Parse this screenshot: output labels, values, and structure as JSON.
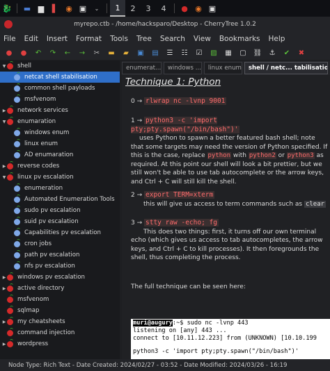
{
  "topbar": {
    "workspaces": [
      "1",
      "2",
      "3",
      "4"
    ],
    "active_workspace": "1"
  },
  "window": {
    "title": "myrepo.ctb - /home/hacksparo/Desktop - CherryTree 1.0.2"
  },
  "menu": [
    "File",
    "Edit",
    "Insert",
    "Format",
    "Tools",
    "Tree",
    "Search",
    "View",
    "Bookmarks",
    "Help"
  ],
  "tree": [
    {
      "label": "shell",
      "level": 0,
      "expanded": true
    },
    {
      "label": "netcat shell stabilisation",
      "level": 1,
      "selected": true
    },
    {
      "label": "common shell payloads",
      "level": 1
    },
    {
      "label": "msfvenom",
      "level": 1
    },
    {
      "label": "network services",
      "level": 0,
      "collapsed": true
    },
    {
      "label": "enumaration",
      "level": 0,
      "expanded": true
    },
    {
      "label": "windows enum",
      "level": 1
    },
    {
      "label": "linux enum",
      "level": 1
    },
    {
      "label": "AD enumaration",
      "level": 1
    },
    {
      "label": "reverse codes",
      "level": 0,
      "collapsed": true
    },
    {
      "label": "linux pv escalation",
      "level": 0,
      "expanded": true
    },
    {
      "label": "enumeration",
      "level": 1
    },
    {
      "label": "Automated Enumeration Tools",
      "level": 1
    },
    {
      "label": "sudo pv escalation",
      "level": 1
    },
    {
      "label": "suid pv escalation",
      "level": 1
    },
    {
      "label": "Capabilities pv escalation",
      "level": 1
    },
    {
      "label": "cron jobs",
      "level": 1
    },
    {
      "label": "path pv escalation",
      "level": 1
    },
    {
      "label": "nfs pv escalation",
      "level": 1
    },
    {
      "label": "windows pv escalation",
      "level": 0,
      "collapsed": true
    },
    {
      "label": "active directory",
      "level": 0,
      "collapsed": true
    },
    {
      "label": "msfvenom",
      "level": 0
    },
    {
      "label": "sqlmap",
      "level": 0
    },
    {
      "label": "my cheatsheets",
      "level": 0,
      "collapsed": true
    },
    {
      "label": "command injection",
      "level": 0
    },
    {
      "label": "wordpress",
      "level": 0,
      "collapsed": true
    }
  ],
  "tabs": [
    {
      "label": "enumerat...",
      "active": false
    },
    {
      "label": "windows ...",
      "active": false
    },
    {
      "label": "linux enum",
      "active": false
    },
    {
      "label": "shell / netc... tabilisation",
      "active": true
    }
  ],
  "doc": {
    "heading": "Technique 1: Python",
    "step0": {
      "num": "0 →",
      "cmd": "rlwrap nc -lvnp 9001"
    },
    "step1": {
      "num": "1 →",
      "cmd": "python3 -c 'import pty;pty.spawn(\"/bin/bash\")'",
      "t1": "uses Python to spawn a better featured bash shell; note that some targets may need the version of Python specified. If this is the case, replace ",
      "w1": "python",
      "t2": " with ",
      "w2": "python2",
      "t3": " or ",
      "w3": "python3",
      "t4": " as required. At this point our shell will look a bit prettier, but we still won't be able to use tab autocomplete or the arrow keys, and Ctrl + C will still kill the shell."
    },
    "step2": {
      "num": "2 →",
      "cmd": "export TERM=xterm",
      "t1": "this will give us access to term commands such as ",
      "w1": "clear"
    },
    "step3": {
      "num": "3 →",
      "cmd": "stty raw -echo; fg",
      "t1": "This does two things: first, it turns off our own terminal echo (which gives us access to tab autocompletes, the arrow keys, and Ctrl + C to kill processes). It then foregrounds the shell, thus completing the process."
    },
    "footer": "The full technique can be seen here:",
    "terminal": {
      "user": "muri@augury",
      "line1": ":~$ sudo nc -lvnp 443",
      "line2": "listening on [any] 443 ...",
      "line3": "connect to [10.11.12.223] from (UNKNOWN) [10.10.199",
      "line4": "python3 -c 'import pty;pty.spawn(\"/bin/bash\")'"
    }
  },
  "status": {
    "text": "Node Type: Rich Text  -  Date Created: 2024/02/27 - 03:52  -  Date Modified: 2024/03/26 - 16:19"
  }
}
